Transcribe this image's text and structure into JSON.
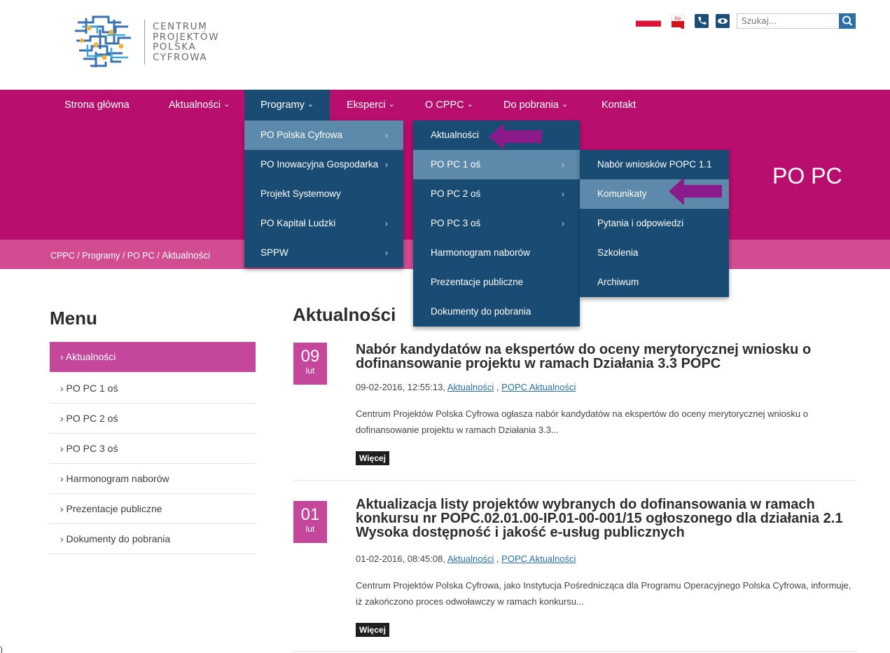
{
  "logo": {
    "line1": "CENTRUM",
    "line2": "PROJEKTÓW",
    "line3": "POLSKA",
    "line4": "CYFROWA"
  },
  "top_tools": {
    "bip_label": "bip",
    "search_placeholder": "Szukaj..."
  },
  "nav": {
    "items": [
      {
        "label": "Strona główna"
      },
      {
        "label": "Aktualności"
      },
      {
        "label": "Programy"
      },
      {
        "label": "Eksperci"
      },
      {
        "label": "O CPPC"
      },
      {
        "label": "Do pobrania"
      },
      {
        "label": "Kontakt"
      }
    ],
    "chevron": "⌄"
  },
  "dropdown_programs": [
    {
      "label": "PO Polska Cyfrowa",
      "arrow": "›"
    },
    {
      "label": "PO Inowacyjna Gospodarka",
      "arrow": "›"
    },
    {
      "label": "Projekt Systemowy",
      "arrow": ""
    },
    {
      "label": "PO Kapitał Ludzki",
      "arrow": "›"
    },
    {
      "label": "SPPW",
      "arrow": "›"
    }
  ],
  "dropdown_popc": [
    {
      "label": "Aktualności",
      "arrow": ""
    },
    {
      "label": "PO PC 1 oś",
      "arrow": "›"
    },
    {
      "label": "PO PC 2 oś",
      "arrow": "›"
    },
    {
      "label": "PO PC 3 oś",
      "arrow": "›"
    },
    {
      "label": "Harmonogram naborów",
      "arrow": ""
    },
    {
      "label": "Prezentacje publiczne",
      "arrow": ""
    },
    {
      "label": "Dokumenty do pobrania",
      "arrow": ""
    }
  ],
  "dropdown_axis1": [
    {
      "label": "Nabór wniosków POPC 1.1"
    },
    {
      "label": "Komunikaty"
    },
    {
      "label": "Pytania i odpowiedzi"
    },
    {
      "label": "Szkolenia"
    },
    {
      "label": "Archiwum"
    }
  ],
  "section_title": "PO PC",
  "breadcrumb": {
    "root": "CPPC",
    "sep": " / ",
    "level1": "Programy",
    "level2": "PO PC",
    "current": "Aktualności"
  },
  "side_menu": {
    "title": "Menu",
    "items": [
      "› Aktualności",
      "› PO PC 1 oś",
      "› PO PC 2 oś",
      "› PO PC 3 oś",
      "› Harmonogram naborów",
      "› Prezentacje publiczne",
      "› Dokumenty do pobrania"
    ]
  },
  "content": {
    "title": "Aktualności",
    "more_label": "Więcej",
    "articles": [
      {
        "day": "09",
        "month": "lut",
        "title": "Nabór kandydatów na ekspertów do oceny merytorycznej wniosku o dofinansowanie projektu w ramach Działania 3.3 POPC",
        "datetime": "09-02-2016, 12:55:13, ",
        "cat1": "Aktualności",
        "cat_sep": " , ",
        "cat2": "POPC Aktualności",
        "body": "Centrum Projektów Polska Cyfrowa ogłasza nabór kandydatów na ekspertów do oceny merytorycznej wniosku o dofinansowanie projektu w ramach Działania 3.3..."
      },
      {
        "day": "01",
        "month": "lut",
        "title": "Aktualizacja listy projektów wybranych do dofinansowania w ramach konkursu nr POPC.02.01.00-IP.01-00-001/15 ogłoszonego dla działania 2.1 Wysoka dostępność i jakość e-usług publicznych",
        "datetime": "01-02-2016, 08:45:08, ",
        "cat1": "Aktualności",
        "cat_sep": " , ",
        "cat2": "POPC Aktualności",
        "body": "Centrum Projektów Polska Cyfrowa, jako Instytucja Pośrednicząca dla Programu Operacyjnego Polska Cyfrowa, informuje, iż zakończono proces odwoławczy w ramach konkursu..."
      }
    ]
  },
  "stray_text": ")",
  "colors": {
    "brand_pink": "#b80e6d",
    "crumb_pink": "#d24c92",
    "menu_navy": "#1a4c73",
    "highlight_blue": "#5d8aab",
    "accent_pink": "#c4479b",
    "marker_purple": "#8b1a8b"
  }
}
